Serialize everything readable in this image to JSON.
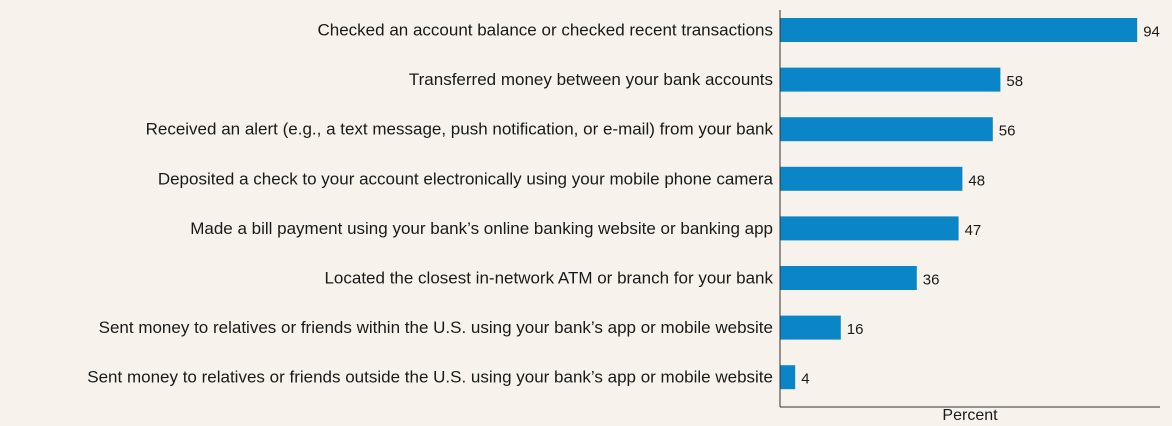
{
  "colors": {
    "bar": "#0a86c8",
    "background": "#f7f3ec",
    "axis": "#333333",
    "text": "#1a1a1a"
  },
  "chart_data": {
    "type": "bar",
    "orientation": "horizontal",
    "categories": [
      "Checked an account balance or checked recent transactions",
      "Transferred money between your bank accounts",
      "Received an alert (e.g., a text message, push notification, or e-mail) from your bank",
      "Deposited a check to your account electronically using your mobile phone camera",
      "Made a bill payment using your bank’s online banking website or banking app",
      "Located the closest in-network ATM or branch for your bank",
      "Sent money to relatives or friends within the U.S. using your bank’s app or mobile website",
      "Sent money to relatives or friends outside the U.S. using your bank’s app or mobile website"
    ],
    "values": [
      94,
      58,
      56,
      48,
      47,
      36,
      16,
      4
    ],
    "title": "",
    "xlabel": "Percent",
    "ylabel": "",
    "xlim": [
      0,
      100
    ],
    "grid": false,
    "legend": "none",
    "data_labels": true
  }
}
